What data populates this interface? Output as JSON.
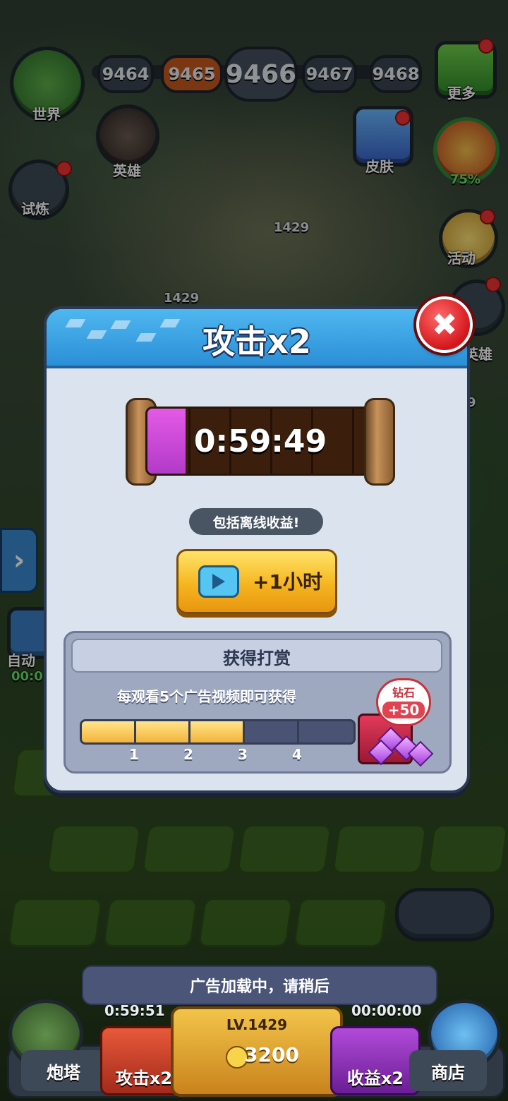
{
  "hud": {
    "levels": [
      "9464",
      "9465",
      "9466",
      "9467",
      "9468"
    ],
    "menu": {
      "world": "世界",
      "hero": "英雄",
      "trial": "试炼",
      "more": "更多",
      "skin": "皮肤",
      "pet_progress": "75%",
      "event": "活动",
      "hero_right": "英雄",
      "auto": "自动",
      "auto_timer": "00:0"
    },
    "map_labels": [
      "1429",
      "1429",
      "9"
    ]
  },
  "popup": {
    "title": "攻击x2",
    "timer": "0:59:49",
    "timer_fill_fraction": 0.17,
    "offline_note": "包括离线收益!",
    "watch_button": "+1小时",
    "reward": {
      "title": "获得打赏",
      "description": "每观看5个广告视频即可获得",
      "progress_watched": 3,
      "progress_total": 5,
      "markers": [
        "1",
        "2",
        "3",
        "4"
      ],
      "badge_title": "钻石",
      "badge_value": "+50"
    }
  },
  "toast": "广告加载中，请稍后",
  "bottom_bar": {
    "turret": "炮塔",
    "attack_timer": "0:59:51",
    "attack": "攻击x2",
    "level": "LV.1429",
    "coins": "3200",
    "income_timer": "00:00:00",
    "income": "收益x2",
    "shop": "商店"
  },
  "colors": {
    "popup_header": "#2b8fd6",
    "capsule_fill": "#e35ae6",
    "watch_button": "#f5b51f",
    "close_button": "#d3161b"
  }
}
